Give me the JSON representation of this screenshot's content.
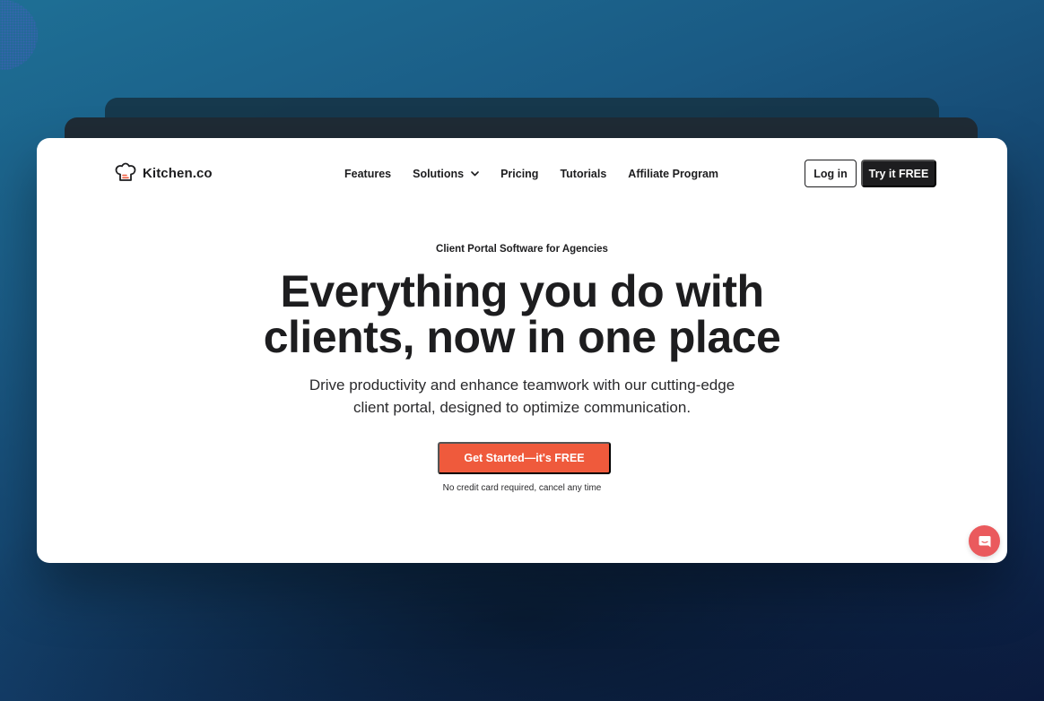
{
  "brand": {
    "name": "Kitchen.co",
    "logo_icon": "chef-hat-icon",
    "accent_color": "#ef5a3c"
  },
  "nav": {
    "items": [
      {
        "label": "Features"
      },
      {
        "label": "Solutions",
        "has_dropdown": true
      },
      {
        "label": "Pricing"
      },
      {
        "label": "Tutorials"
      },
      {
        "label": "Affiliate Program"
      }
    ],
    "login_label": "Log in",
    "try_label": "Try it FREE"
  },
  "hero": {
    "eyebrow": "Client Portal Software for Agencies",
    "headline_line1": "Everything you do with",
    "headline_line2": "clients, now in one place",
    "subhead": "Drive productivity and enhance teamwork with our cutting-edge client portal, designed to optimize communication.",
    "cta_label": "Get Started—it's FREE",
    "cta_note": "No credit card required, cancel any time"
  },
  "chat": {
    "icon": "chat-icon",
    "color": "#ea5a5d"
  }
}
